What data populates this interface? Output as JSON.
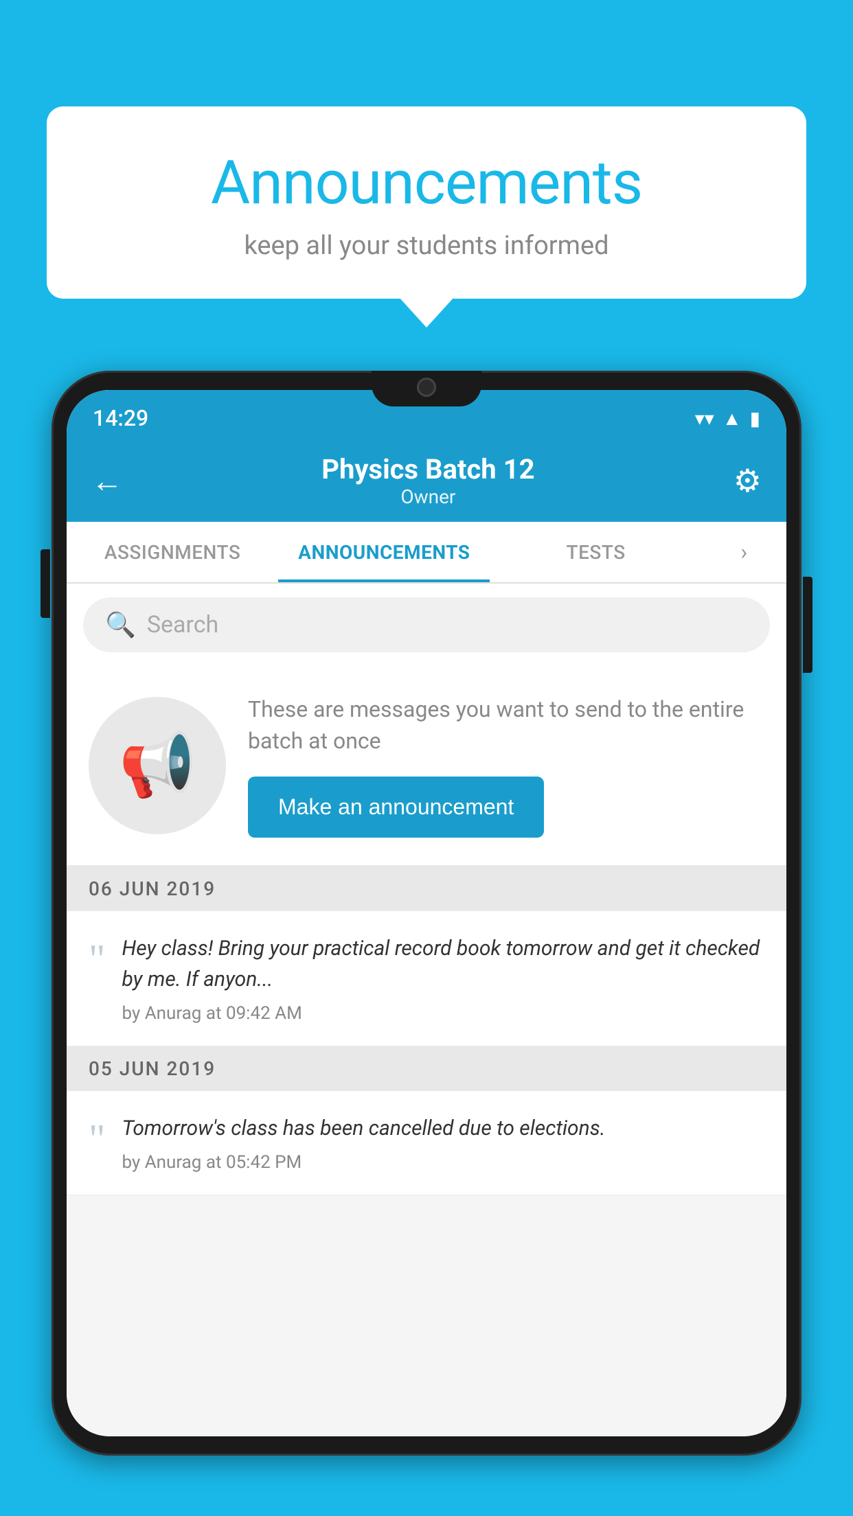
{
  "page": {
    "background_color": "#1ab8e8"
  },
  "speech_bubble": {
    "title": "Announcements",
    "subtitle": "keep all your students informed"
  },
  "phone": {
    "status_bar": {
      "time": "14:29",
      "wifi_symbol": "▼",
      "signal_symbol": "▲",
      "battery_symbol": "▮"
    },
    "header": {
      "back_icon": "←",
      "title": "Physics Batch 12",
      "subtitle": "Owner",
      "gear_icon": "⚙"
    },
    "tabs": [
      {
        "label": "ASSIGNMENTS",
        "active": false
      },
      {
        "label": "ANNOUNCEMENTS",
        "active": true
      },
      {
        "label": "TESTS",
        "active": false
      }
    ],
    "search": {
      "placeholder": "Search",
      "icon": "🔍"
    },
    "announcement_intro": {
      "icon_label": "megaphone",
      "description": "These are messages you want to send to the entire batch at once",
      "button_label": "Make an announcement"
    },
    "announcements": [
      {
        "date": "06  JUN  2019",
        "text": "Hey class! Bring your practical record book tomorrow and get it checked by me. If anyon...",
        "meta": "by Anurag at 09:42 AM"
      },
      {
        "date": "05  JUN  2019",
        "text": "Tomorrow's class has been cancelled due to elections.",
        "meta": "by Anurag at 05:42 PM"
      }
    ]
  }
}
